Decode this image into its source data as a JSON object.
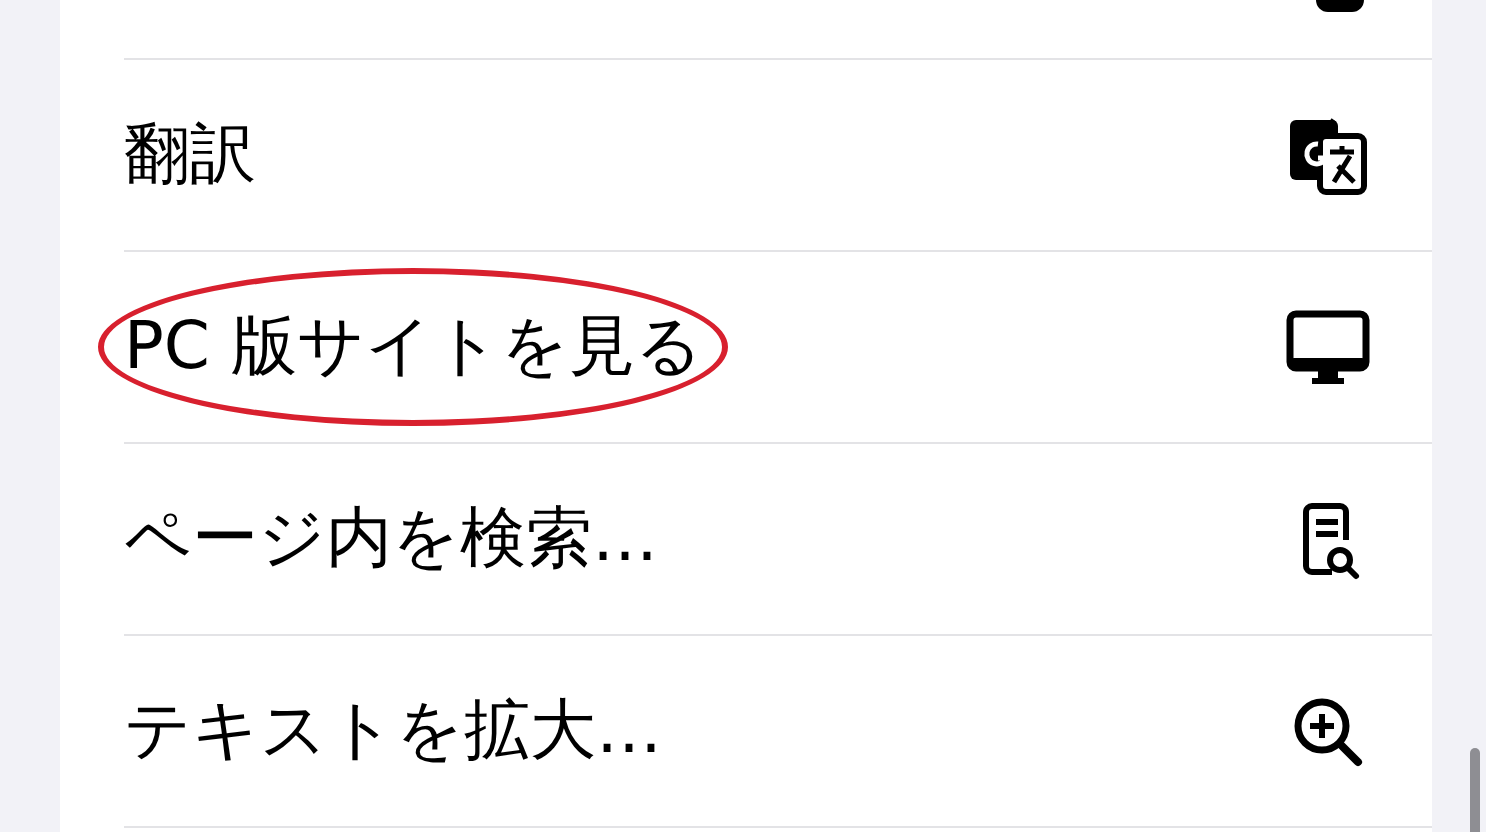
{
  "menu_items": [
    {
      "label": "翻訳",
      "kind": "translate",
      "highlighted": false
    },
    {
      "label": "PC 版サイトを見る",
      "kind": "desktop",
      "highlighted": true
    },
    {
      "label": "ページ内を検索…",
      "kind": "find",
      "highlighted": false
    },
    {
      "label": "テキストを拡大…",
      "kind": "zoom",
      "highlighted": false
    }
  ]
}
